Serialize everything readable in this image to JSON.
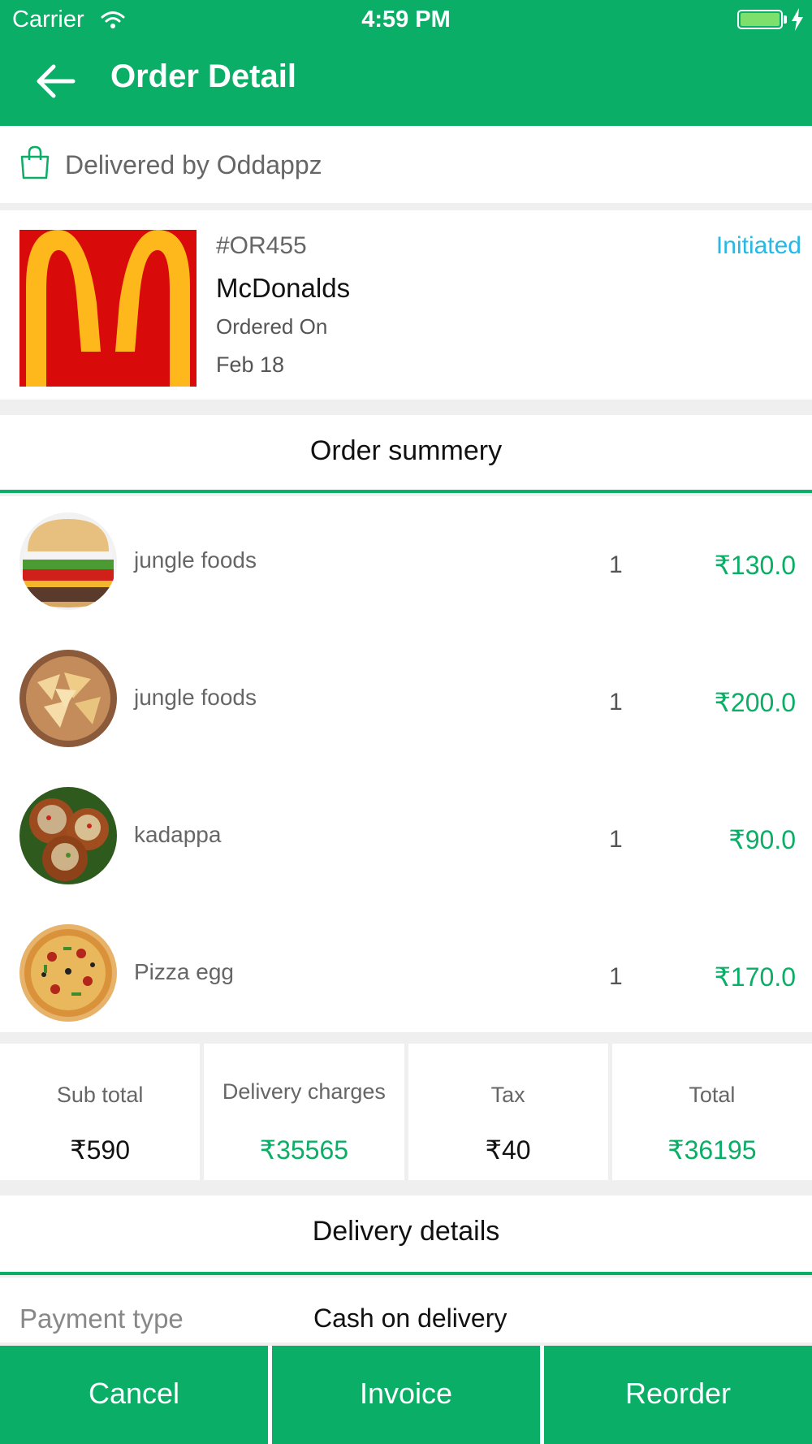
{
  "status_bar": {
    "carrier": "Carrier",
    "time": "4:59 PM",
    "battery_level": 1.0
  },
  "header": {
    "title": "Order Detail"
  },
  "delivered_by": {
    "text": "Delivered by Oddappz"
  },
  "order": {
    "id": "#OR455",
    "status": "Initiated",
    "restaurant": "McDonalds",
    "ordered_label": "Ordered On",
    "date": "Feb 18"
  },
  "order_summary": {
    "title": "Order summery"
  },
  "items": [
    {
      "name": "jungle foods",
      "qty": "1",
      "price": "₹130.0",
      "image": "burger"
    },
    {
      "name": "jungle foods",
      "qty": "1",
      "price": "₹200.0",
      "image": "nachos"
    },
    {
      "name": "kadappa",
      "qty": "1",
      "price": "₹90.0",
      "image": "stuffed-bites"
    },
    {
      "name": "Pizza egg",
      "qty": "1",
      "price": "₹170.0",
      "image": "pizza"
    }
  ],
  "totals": {
    "subtotal": {
      "label": "Sub total",
      "value": "₹590"
    },
    "delivery": {
      "label": "Delivery charges",
      "value": "₹35565"
    },
    "tax": {
      "label": "Tax",
      "value": "₹40"
    },
    "total": {
      "label": "Total",
      "value": "₹36195"
    }
  },
  "delivery_details": {
    "title": "Delivery details"
  },
  "payment": {
    "label": "Payment type",
    "value": "Cash on delivery"
  },
  "actions": {
    "cancel": "Cancel",
    "invoice": "Invoice",
    "reorder": "Reorder"
  },
  "colors": {
    "brand_green": "#0bae66",
    "status_blue": "#26b8e6",
    "logo_red": "#d80a0a",
    "logo_yellow": "#ffb81c"
  }
}
